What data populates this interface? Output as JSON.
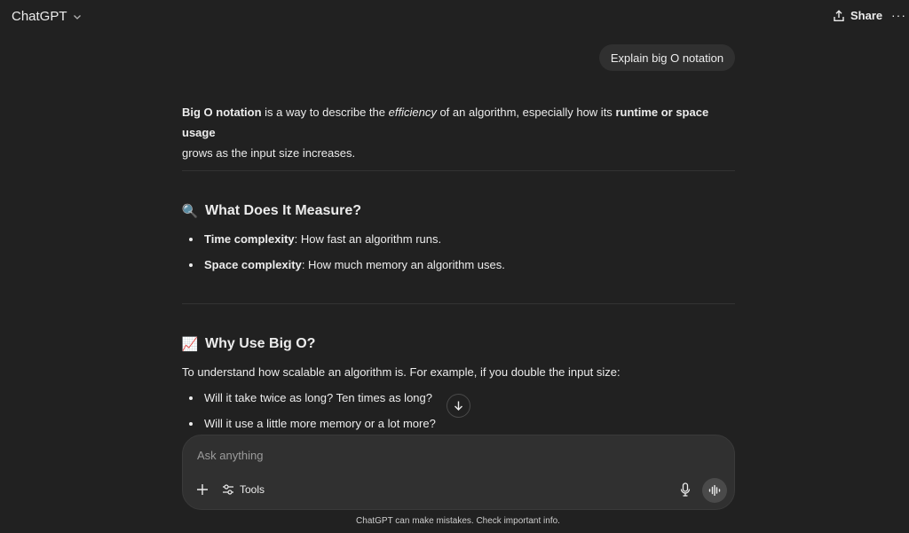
{
  "header": {
    "model_label": "ChatGPT",
    "share_label": "Share",
    "more_label": "···"
  },
  "user_message": "Explain big O notation",
  "answer": {
    "intro": {
      "p1": "Big O notation",
      "p2": " is a way to describe the ",
      "p3": "efficiency",
      "p4": " of an algorithm, especially how its ",
      "p5": "runtime or space usage",
      "p6": "grows as the input size increases."
    },
    "section1": {
      "emoji": "🔍",
      "title": "What Does It Measure?",
      "items": [
        {
          "term": "Time complexity",
          "desc": ": How fast an algorithm runs."
        },
        {
          "term": "Space complexity",
          "desc": ": How much memory an algorithm uses."
        }
      ]
    },
    "section2": {
      "emoji": "📈",
      "title": "Why Use Big O?",
      "text": "To understand how scalable an algorithm is. For example, if you double the input size:",
      "items": [
        "Will it take twice as long? Ten times as long?",
        "Will it use a little more memory or a lot more?"
      ]
    }
  },
  "composer": {
    "placeholder": "Ask anything",
    "tools_label": "Tools"
  },
  "footer": {
    "disclaimer": "ChatGPT can make mistakes. Check important info."
  },
  "icons": {
    "share": "share-icon",
    "plus": "plus-icon",
    "tools": "sliders-icon",
    "mic": "microphone-icon",
    "voice": "voice-waveform-icon",
    "scroll": "arrow-down-icon"
  }
}
